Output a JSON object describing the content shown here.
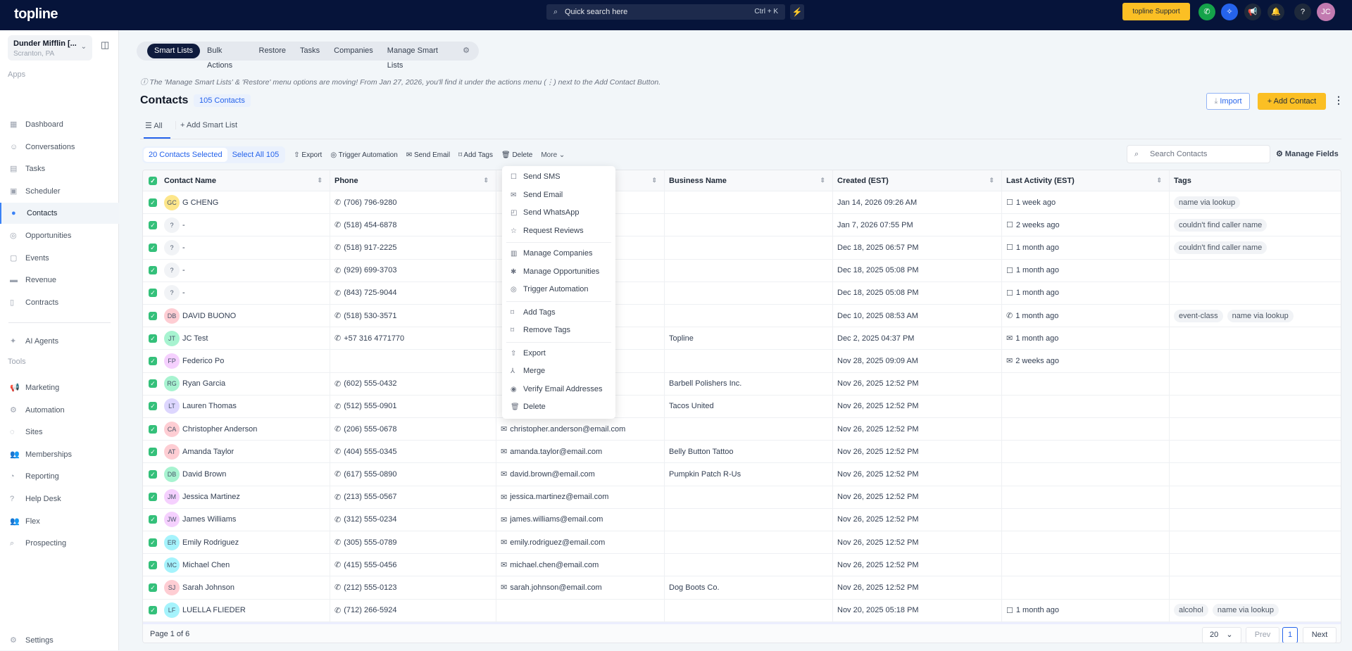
{
  "topbar": {
    "logo": "topline",
    "search_placeholder": "Quick search here",
    "shortcut": "Ctrl + K",
    "support": "topline Support",
    "avatar": "JC"
  },
  "sidebar": {
    "account_name": "Dunder Mifflin [...",
    "account_location": "Scranton, PA",
    "apps_label": "Apps",
    "tools_label": "Tools",
    "apps": [
      {
        "label": "Dashboard",
        "icon": "dashboard-icon"
      },
      {
        "label": "Conversations",
        "icon": "chat-icon"
      },
      {
        "label": "Tasks",
        "icon": "task-icon"
      },
      {
        "label": "Scheduler",
        "icon": "calendar-icon"
      },
      {
        "label": "Contacts",
        "icon": "user-icon"
      },
      {
        "label": "Opportunities",
        "icon": "target-icon"
      },
      {
        "label": "Events",
        "icon": "event-icon"
      },
      {
        "label": "Revenue",
        "icon": "card-icon"
      },
      {
        "label": "Contracts",
        "icon": "document-icon"
      }
    ],
    "ai_agents": "AI Agents",
    "tools": [
      {
        "label": "Marketing"
      },
      {
        "label": "Automation"
      },
      {
        "label": "Sites"
      },
      {
        "label": "Memberships"
      },
      {
        "label": "Reporting"
      },
      {
        "label": "Help Desk"
      },
      {
        "label": "Flex"
      },
      {
        "label": "Prospecting"
      }
    ],
    "settings": "Settings"
  },
  "tabs": [
    "Smart Lists",
    "Bulk Actions",
    "Restore",
    "Tasks",
    "Companies",
    "Manage Smart Lists"
  ],
  "notice": "ⓘ The 'Manage Smart Lists' & 'Restore' menu options are moving! From Jan 27, 2026, you'll find it under the actions menu (⋮) next to the Add Contact Button.",
  "header": {
    "title": "Contacts",
    "count": "105 Contacts",
    "import": "Import",
    "add_contact": "Add Contact"
  },
  "list_tabs": {
    "all": "All",
    "add": "Add Smart List"
  },
  "actions": {
    "selected": "20 Contacts Selected",
    "select_all": "Select All 105",
    "export": "Export",
    "trigger": "Trigger Automation",
    "send_email": "Send Email",
    "add_tags": "Add Tags",
    "delete": "Delete",
    "more": "More"
  },
  "search_contacts": "Search Contacts",
  "manage_fields": "Manage Fields",
  "columns": [
    "Contact Name",
    "Phone",
    "",
    "Business Name",
    "Created (EST)",
    "Last Activity (EST)",
    "Tags"
  ],
  "rows": [
    {
      "init": "GC",
      "color": "#fde68a",
      "name": "G CHENG",
      "phone": "(706) 796-9280",
      "email": "",
      "biz": "",
      "created": "Jan 14, 2026 09:26 AM",
      "act_icon": "chat",
      "activity": "1 week ago",
      "tags": [
        "name via lookup"
      ]
    },
    {
      "init": "?",
      "color": "#f1f3f6",
      "name": "-",
      "phone": "(518) 454-6878",
      "email": "",
      "biz": "",
      "created": "Jan 7, 2026 07:55 PM",
      "act_icon": "chat",
      "activity": "2 weeks ago",
      "tags": [
        "couldn't find caller name"
      ]
    },
    {
      "init": "?",
      "color": "#f1f3f6",
      "name": "-",
      "phone": "(518) 917-2225",
      "email": "",
      "biz": "",
      "created": "Dec 18, 2025 06:57 PM",
      "act_icon": "chat",
      "activity": "1 month ago",
      "tags": [
        "couldn't find caller name"
      ]
    },
    {
      "init": "?",
      "color": "#f1f3f6",
      "name": "-",
      "phone": "(929) 699-3703",
      "email": "",
      "biz": "",
      "created": "Dec 18, 2025 05:08 PM",
      "act_icon": "chat",
      "activity": "1 month ago",
      "tags": []
    },
    {
      "init": "?",
      "color": "#f1f3f6",
      "name": "-",
      "phone": "(843) 725-9044",
      "email": "",
      "biz": "",
      "created": "Dec 18, 2025 05:08 PM",
      "act_icon": "chat",
      "activity": "1 month ago",
      "tags": []
    },
    {
      "init": "DB",
      "color": "#fecdd3",
      "name": "DAVID BUONO",
      "phone": "(518) 530-3571",
      "email": "",
      "biz": "",
      "created": "Dec 10, 2025 08:53 AM",
      "act_icon": "phone",
      "activity": "1 month ago",
      "tags": [
        "event-class",
        "name via lookup"
      ]
    },
    {
      "init": "JT",
      "color": "#a7f3d0",
      "name": "JC Test",
      "phone": "+57 316 4771770",
      "email": "",
      "biz": "Topline",
      "created": "Dec 2, 2025 04:37 PM",
      "act_icon": "mail",
      "activity": "1 month ago",
      "tags": []
    },
    {
      "init": "FP",
      "color": "#f5d0fe",
      "name": "Federico Po",
      "phone": "",
      "email": "",
      "biz": "",
      "created": "Nov 28, 2025 09:09 AM",
      "act_icon": "mail",
      "activity": "2 weeks ago",
      "tags": []
    },
    {
      "init": "RG",
      "color": "#a7f3d0",
      "name": "Ryan Garcia",
      "phone": "(602) 555-0432",
      "email": "",
      "biz": "Barbell Polishers Inc.",
      "created": "Nov 26, 2025 12:52 PM",
      "act_icon": "",
      "activity": "",
      "tags": []
    },
    {
      "init": "LT",
      "color": "#ddd6fe",
      "name": "Lauren Thomas",
      "phone": "(512) 555-0901",
      "email": "",
      "biz": "Tacos United",
      "created": "Nov 26, 2025 12:52 PM",
      "act_icon": "",
      "activity": "",
      "tags": []
    },
    {
      "init": "CA",
      "color": "#fecdd3",
      "name": "Christopher Anderson",
      "phone": "(206) 555-0678",
      "email": "christopher.anderson@email.com",
      "biz": "",
      "created": "Nov 26, 2025 12:52 PM",
      "act_icon": "",
      "activity": "",
      "tags": []
    },
    {
      "init": "AT",
      "color": "#fecdd3",
      "name": "Amanda Taylor",
      "phone": "(404) 555-0345",
      "email": "amanda.taylor@email.com",
      "biz": "Belly Button Tattoo",
      "created": "Nov 26, 2025 12:52 PM",
      "act_icon": "",
      "activity": "",
      "tags": []
    },
    {
      "init": "DB",
      "color": "#a7f3d0",
      "name": "David Brown",
      "phone": "(617) 555-0890",
      "email": "david.brown@email.com",
      "biz": "Pumpkin Patch R-Us",
      "created": "Nov 26, 2025 12:52 PM",
      "act_icon": "",
      "activity": "",
      "tags": []
    },
    {
      "init": "JM",
      "color": "#f5d0fe",
      "name": "Jessica Martinez",
      "phone": "(213) 555-0567",
      "email": "jessica.martinez@email.com",
      "biz": "",
      "created": "Nov 26, 2025 12:52 PM",
      "act_icon": "",
      "activity": "",
      "tags": []
    },
    {
      "init": "JW",
      "color": "#f5d0fe",
      "name": "James Williams",
      "phone": "(312) 555-0234",
      "email": "james.williams@email.com",
      "biz": "",
      "created": "Nov 26, 2025 12:52 PM",
      "act_icon": "",
      "activity": "",
      "tags": []
    },
    {
      "init": "ER",
      "color": "#a5f3fc",
      "name": "Emily Rodriguez",
      "phone": "(305) 555-0789",
      "email": "emily.rodriguez@email.com",
      "biz": "",
      "created": "Nov 26, 2025 12:52 PM",
      "act_icon": "",
      "activity": "",
      "tags": []
    },
    {
      "init": "MC",
      "color": "#a5f3fc",
      "name": "Michael Chen",
      "phone": "(415) 555-0456",
      "email": "michael.chen@email.com",
      "biz": "",
      "created": "Nov 26, 2025 12:52 PM",
      "act_icon": "",
      "activity": "",
      "tags": []
    },
    {
      "init": "SJ",
      "color": "#fecdd3",
      "name": "Sarah Johnson",
      "phone": "(212) 555-0123",
      "email": "sarah.johnson@email.com",
      "biz": "Dog Boots Co.",
      "created": "Nov 26, 2025 12:52 PM",
      "act_icon": "",
      "activity": "",
      "tags": []
    },
    {
      "init": "LF",
      "color": "#a5f3fc",
      "name": "LUELLA FLIEDER",
      "phone": "(712) 266-5924",
      "email": "",
      "biz": "",
      "created": "Nov 20, 2025 05:18 PM",
      "act_icon": "chat",
      "activity": "1 month ago",
      "tags": [
        "alcohol",
        "name via lookup"
      ]
    }
  ],
  "pagination": {
    "page_label": "Page 1 of 6",
    "page_size": "20",
    "prev": "Prev",
    "current": "1",
    "next": "Next"
  },
  "more_menu": [
    [
      {
        "label": "Send SMS",
        "icon": "☐"
      },
      {
        "label": "Send Email",
        "icon": "✉"
      },
      {
        "label": "Send WhatsApp",
        "icon": "◰"
      },
      {
        "label": "Request Reviews",
        "icon": "☆"
      }
    ],
    [
      {
        "label": "Manage Companies",
        "icon": "▥"
      },
      {
        "label": "Manage Opportunities",
        "icon": "✱"
      },
      {
        "label": "Trigger Automation",
        "icon": "◎"
      }
    ],
    [
      {
        "label": "Add Tags",
        "icon": "⌑"
      },
      {
        "label": "Remove Tags",
        "icon": "⌑"
      }
    ],
    [
      {
        "label": "Export",
        "icon": "⇧"
      },
      {
        "label": "Merge",
        "icon": "⅄"
      },
      {
        "label": "Verify Email Addresses",
        "icon": "◉"
      },
      {
        "label": "Delete",
        "icon": "🗑"
      }
    ]
  ]
}
